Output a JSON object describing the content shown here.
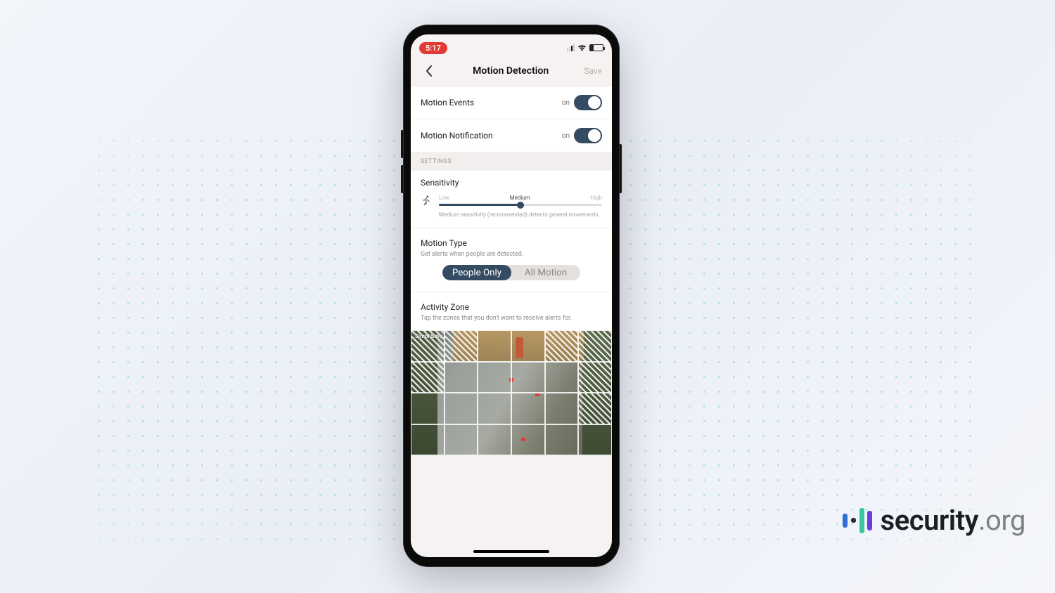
{
  "status_bar": {
    "time": "5:17"
  },
  "nav": {
    "title": "Motion Detection",
    "save_label": "Save"
  },
  "rows": {
    "motion_events": {
      "label": "Motion Events",
      "state": "on"
    },
    "motion_notification": {
      "label": "Motion Notification",
      "state": "on"
    }
  },
  "section_header": "SETTINGS",
  "sensitivity": {
    "title": "Sensitivity",
    "low": "Low",
    "medium": "Medium",
    "high": "High",
    "note": "Medium sensitivity (recommended) detects general movements."
  },
  "motion_type": {
    "title": "Motion Type",
    "subtitle": "Get alerts when people are detected.",
    "option_people": "People Only",
    "option_all": "All Motion"
  },
  "activity_zone": {
    "title": "Activity Zone",
    "subtitle": "Tap the zones that you don't want to receive alerts for.",
    "camera_label": "SimpliSafe"
  },
  "brand": {
    "name": "security",
    "tld": ".org"
  }
}
